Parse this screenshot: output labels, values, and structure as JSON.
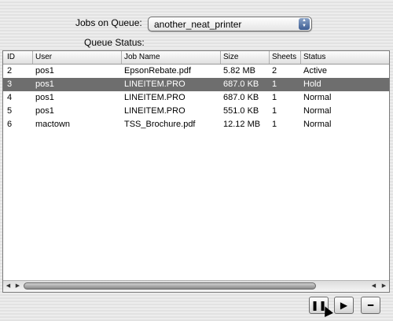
{
  "header": {
    "jobs_label": "Jobs on Queue:",
    "queue_value": "another_neat_printer",
    "status_label": "Queue Status:"
  },
  "table": {
    "columns": [
      "ID",
      "User",
      "Job Name",
      "Size",
      "Sheets",
      "Status"
    ],
    "rows": [
      {
        "id": "2",
        "user": "pos1",
        "job": "EpsonRebate.pdf",
        "size": "5.82 MB",
        "sheets": "2",
        "status": "Active"
      },
      {
        "id": "3",
        "user": "pos1",
        "job": "LINEITEM.PRO",
        "size": "687.0 KB",
        "sheets": "1",
        "status": "Hold"
      },
      {
        "id": "4",
        "user": "pos1",
        "job": "LINEITEM.PRO",
        "size": "687.0 KB",
        "sheets": "1",
        "status": "Normal"
      },
      {
        "id": "5",
        "user": "pos1",
        "job": "LINEITEM.PRO",
        "size": "551.0 KB",
        "sheets": "1",
        "status": "Normal"
      },
      {
        "id": "6",
        "user": "mactown",
        "job": "TSS_Brochure.pdf",
        "size": "12.12 MB",
        "sheets": "1",
        "status": "Normal"
      }
    ],
    "selected_row": 1
  },
  "colors": {
    "selection": "#6e6e6e",
    "popup_arrows": "#4a6ba3"
  },
  "icons": {
    "hold": "pause-icon",
    "resume": "play-icon",
    "delete": "minus-icon"
  }
}
